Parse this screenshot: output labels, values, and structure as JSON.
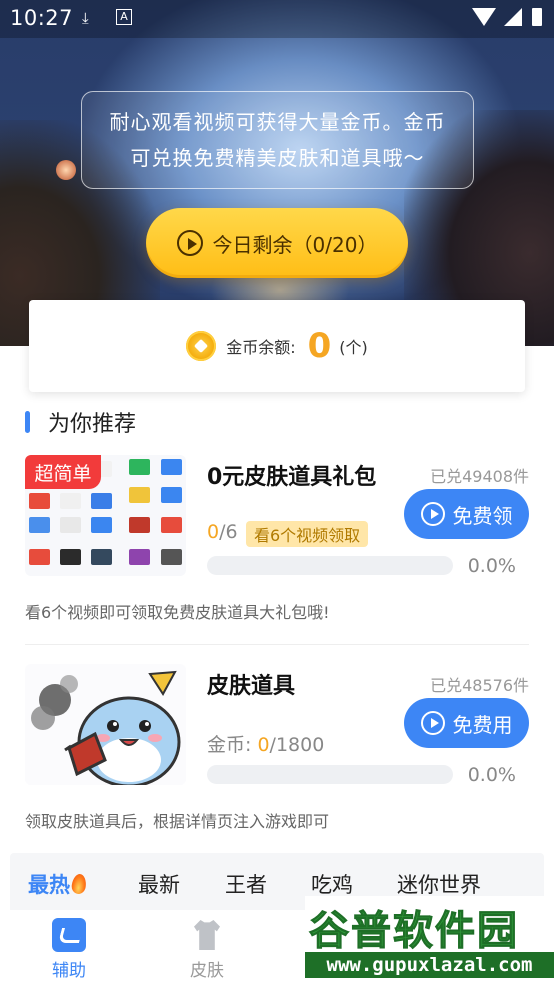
{
  "status_bar": {
    "time": "10:27"
  },
  "hero": {
    "notice": "耐心观看视频可获得大量金币。金币可兑换免费精美皮肤和道具哦～",
    "remaining_button": "今日剩余（0/20）"
  },
  "balance": {
    "label": "金币余额:",
    "value": "0",
    "unit": "(个)"
  },
  "section": {
    "title": "为你推荐"
  },
  "products": [
    {
      "badge": "超简单",
      "title": "0元皮肤道具礼包",
      "exchanged": "已兑49408件",
      "button": "免费领",
      "progress_current": "0",
      "progress_total": "/6",
      "tag": "看6个视频领取",
      "percent_text": "0.0%",
      "progress": 0.0,
      "description": "看6个视频即可领取免费皮肤道具大礼包哦!"
    },
    {
      "title": "皮肤道具",
      "exchanged": "已兑48576件",
      "button": "免费用",
      "cost_label": "金币: ",
      "progress_current": "0",
      "progress_total": "/1800",
      "percent_text": "0.0%",
      "progress": 0.0,
      "description": "领取皮肤道具后，根据详情页注入游戏即可"
    }
  ],
  "category_tabs": [
    "最热",
    "最新",
    "王者",
    "吃鸡",
    "迷你世界"
  ],
  "bottom_nav": [
    "辅助",
    "皮肤"
  ],
  "watermark": {
    "title": "谷普软件园",
    "url": "www.gupuxlazal.com"
  },
  "colors": {
    "accent": "#3d86f5",
    "gold": "#f5a623",
    "badge_red": "#f23b3b"
  }
}
